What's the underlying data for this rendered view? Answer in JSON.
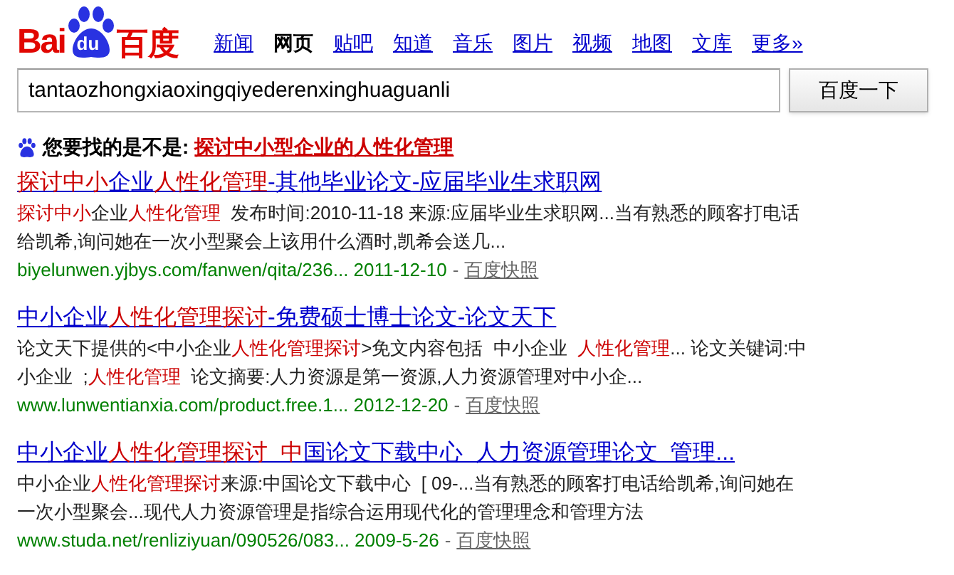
{
  "logo": {
    "left": "Bai",
    "paw": "du",
    "right": "百度"
  },
  "nav": [
    {
      "label": "新闻",
      "selected": false
    },
    {
      "label": "网页",
      "selected": true
    },
    {
      "label": "贴吧",
      "selected": false
    },
    {
      "label": "知道",
      "selected": false
    },
    {
      "label": "音乐",
      "selected": false
    },
    {
      "label": "图片",
      "selected": false
    },
    {
      "label": "视频",
      "selected": false
    },
    {
      "label": "地图",
      "selected": false
    },
    {
      "label": "文库",
      "selected": false
    },
    {
      "label": "更多»",
      "selected": false
    }
  ],
  "search": {
    "value": "tantaozhongxiaoxingqiyederenxinghuaguanli",
    "button": "百度一下"
  },
  "suggestion": {
    "prompt": "您要找的是不是:",
    "query": "探讨中小型企业的人性化管理"
  },
  "results": [
    {
      "title": [
        {
          "text": "探讨中小",
          "highlight": true
        },
        {
          "text": "企业",
          "highlight": false
        },
        {
          "text": "人性化管理",
          "highlight": true
        },
        {
          "text": "-其他毕业论文-应届毕业生求职网",
          "highlight": false
        }
      ],
      "snippet": [
        {
          "text": "探讨中小",
          "highlight": true
        },
        {
          "text": "企业",
          "highlight": false
        },
        {
          "text": "人性化管理",
          "highlight": true
        },
        {
          "text": "  发布时间:2010-11-18 来源:应届毕业生求职网...当有熟悉的顾客打电话给凯希,询问她在一次小型聚会上该用什么酒时,凯希会送几...",
          "highlight": false
        }
      ],
      "url": "biyelunwen.yjbys.com/fanwen/qita/236...",
      "date": "2011-12-10",
      "separator": "-",
      "cache": "百度快照"
    },
    {
      "title": [
        {
          "text": "中小企业",
          "highlight": false
        },
        {
          "text": "人性化管理探讨",
          "highlight": true
        },
        {
          "text": "-免费硕士博士论文-论文天下",
          "highlight": false
        }
      ],
      "snippet": [
        {
          "text": "论文天下提供的<中小企业",
          "highlight": false
        },
        {
          "text": "人性化管理探讨",
          "highlight": true
        },
        {
          "text": ">免文内容包括  中小企业  ",
          "highlight": false
        },
        {
          "text": "人性化管理",
          "highlight": true
        },
        {
          "text": "... 论文关键词:中小企业  ;",
          "highlight": false
        },
        {
          "text": "人性化管理",
          "highlight": true
        },
        {
          "text": "  论文摘要:人力资源是第一资源,人力资源管理对中小企...",
          "highlight": false
        }
      ],
      "url": "www.lunwentianxia.com/product.free.1...",
      "date": "2012-12-20",
      "separator": "-",
      "cache": "百度快照"
    },
    {
      "title": [
        {
          "text": "中小企业",
          "highlight": false
        },
        {
          "text": "人性化管理探讨  中",
          "highlight": true
        },
        {
          "text": "国论文下载中心  人力资源管理论文  管理...",
          "highlight": false
        }
      ],
      "snippet": [
        {
          "text": "中小企业",
          "highlight": false
        },
        {
          "text": "人性化管理探讨",
          "highlight": true
        },
        {
          "text": "来源:中国论文下载中心  [ 09-...当有熟悉的顾客打电话给凯希,询问她在一次小型聚会...现代人力资源管理是指综合运用现代化的管理理念和管理方法",
          "highlight": false
        }
      ],
      "url": "www.studa.net/renliziyuan/090526/083...",
      "date": "2009-5-26",
      "separator": "-",
      "cache": "百度快照"
    }
  ]
}
